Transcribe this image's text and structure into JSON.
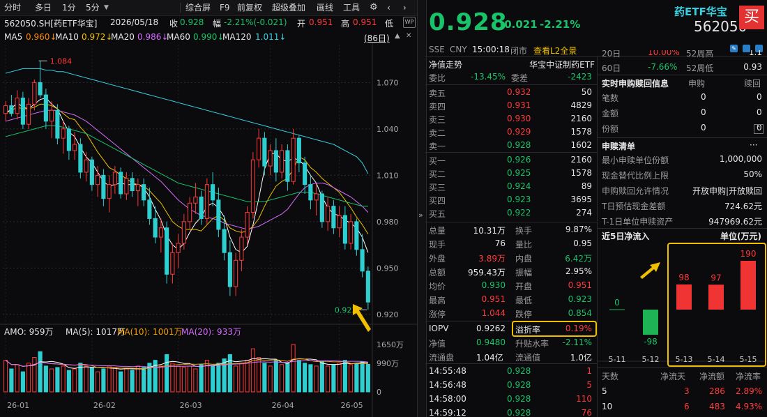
{
  "toolbar": {
    "tabs": [
      "分时",
      "多日",
      "1分",
      "5分"
    ],
    "dropdown_icon": "chevron-down-icon",
    "right": [
      "综合屏",
      "F9",
      "前复权",
      "超级叠加",
      "画线",
      "工具"
    ]
  },
  "info": {
    "code": "562050.SH[药ETF华宝]",
    "date": "2026/05/18",
    "close_label": "收",
    "close": "0.928",
    "amp_label": "幅",
    "amp": "-2.21%(-0.021)",
    "open_label": "开",
    "open": "0.951",
    "high_label": "高",
    "high": "0.951",
    "low_label": "低"
  },
  "ma": {
    "ma5_label": "MA5",
    "ma5": "0.960↓",
    "ma10_label": "MA10",
    "ma10": "0.972↓",
    "ma20_label": "MA20",
    "ma20": "0.986↓",
    "ma60_label": "MA60",
    "ma60": "0.990↓",
    "ma120_label": "MA120",
    "ma120": "1.011↓",
    "period": "(86日)"
  },
  "chart_data": {
    "type": "candlestick",
    "yticks": [
      "1.070",
      "1.040",
      "1.010",
      "0.980",
      "0.950",
      "0.920"
    ],
    "ylim": [
      0.915,
      1.09
    ],
    "max_label": "1.084",
    "min_label": "0.923",
    "xticks": [
      "26-01",
      "26-02",
      "26-03",
      "26-04",
      "26-05"
    ],
    "volume": {
      "label_text": "AMO: 959万",
      "ma5_text": "MA(5): 1017万",
      "ma10_text": "MA(10): 1001万",
      "ma20_text": "MA(20): 933万",
      "yticks": [
        "1650万",
        "990万",
        "0"
      ],
      "max": 1650
    },
    "candles": [
      [
        1.05,
        1.058,
        1.045,
        1.055
      ],
      [
        1.055,
        1.062,
        1.048,
        1.05
      ],
      [
        1.05,
        1.065,
        1.046,
        1.06
      ],
      [
        1.06,
        1.064,
        1.04,
        1.043
      ],
      [
        1.043,
        1.06,
        1.04,
        1.056
      ],
      [
        1.056,
        1.072,
        1.052,
        1.07
      ],
      [
        1.07,
        1.084,
        1.06,
        1.062
      ],
      [
        1.062,
        1.066,
        1.04,
        1.045
      ],
      [
        1.045,
        1.058,
        1.034,
        1.052
      ],
      [
        1.052,
        1.056,
        1.03,
        1.034
      ],
      [
        1.034,
        1.045,
        1.024,
        1.04
      ],
      [
        1.04,
        1.042,
        1.02,
        1.026
      ],
      [
        1.026,
        1.038,
        1.02,
        1.03
      ],
      [
        1.03,
        1.034,
        1.008,
        1.012
      ],
      [
        1.012,
        1.025,
        1.006,
        1.02
      ],
      [
        1.02,
        1.022,
        1.0,
        1.004
      ],
      [
        1.004,
        1.016,
        0.996,
        1.01
      ],
      [
        1.01,
        1.014,
        0.99,
        0.995
      ],
      [
        0.995,
        1.01,
        0.986,
        1.004
      ],
      [
        1.004,
        1.016,
        0.998,
        1.012
      ],
      [
        1.012,
        1.015,
        0.995,
        0.998
      ],
      [
        0.998,
        1.012,
        0.994,
        1.008
      ],
      [
        1.008,
        1.012,
        0.996,
        1.0
      ],
      [
        1.0,
        1.008,
        0.99,
        1.004
      ],
      [
        1.004,
        1.008,
        0.99,
        0.994
      ],
      [
        0.994,
        1.002,
        0.978,
        0.982
      ],
      [
        0.982,
        0.99,
        0.966,
        0.97
      ],
      [
        0.97,
        0.982,
        0.96,
        0.976
      ],
      [
        0.976,
        0.98,
        0.94,
        0.946
      ],
      [
        0.946,
        0.966,
        0.94,
        0.96
      ],
      [
        0.96,
        0.972,
        0.95,
        0.966
      ],
      [
        0.966,
        0.985,
        0.962,
        0.98
      ],
      [
        0.98,
        0.996,
        0.975,
        0.992
      ],
      [
        0.992,
        1.005,
        0.985,
        0.996
      ],
      [
        0.996,
        1.0,
        0.978,
        0.982
      ],
      [
        0.982,
        1.008,
        0.978,
        1.004
      ],
      [
        1.004,
        1.012,
        0.99,
        0.994
      ],
      [
        0.994,
        1.002,
        0.97,
        0.975
      ],
      [
        0.975,
        0.984,
        0.955,
        0.96
      ],
      [
        0.96,
        0.968,
        0.932,
        0.938
      ],
      [
        0.938,
        0.96,
        0.932,
        0.955
      ],
      [
        0.955,
        0.975,
        0.948,
        0.97
      ],
      [
        0.97,
        0.99,
        0.965,
        0.986
      ],
      [
        0.986,
        1.025,
        0.982,
        1.02
      ],
      [
        1.02,
        1.04,
        1.015,
        1.034
      ],
      [
        1.034,
        1.038,
        1.01,
        1.016
      ],
      [
        1.016,
        1.03,
        1.01,
        1.026
      ],
      [
        1.026,
        1.034,
        1.006,
        1.012
      ],
      [
        1.012,
        1.03,
        1.008,
        1.026
      ],
      [
        1.026,
        1.03,
        1.0,
        1.006
      ],
      [
        1.006,
        1.04,
        1.004,
        1.034
      ],
      [
        1.034,
        1.036,
        1.012,
        1.018
      ],
      [
        1.018,
        1.022,
        0.998,
        1.004
      ],
      [
        1.004,
        1.01,
        0.988,
        0.994
      ],
      [
        0.994,
        1.004,
        0.984,
        0.998
      ],
      [
        0.998,
        1.0,
        0.976,
        0.98
      ],
      [
        0.98,
        0.996,
        0.974,
        0.99
      ],
      [
        0.99,
        0.994,
        0.972,
        0.976
      ],
      [
        0.976,
        0.99,
        0.97,
        0.984
      ],
      [
        0.984,
        0.99,
        0.962,
        0.966
      ],
      [
        0.966,
        0.985,
        0.962,
        0.98
      ],
      [
        0.98,
        0.982,
        0.958,
        0.962
      ],
      [
        0.962,
        0.972,
        0.944,
        0.948
      ],
      [
        0.948,
        0.951,
        0.923,
        0.928
      ]
    ],
    "ma_series": [
      {
        "color": "#ffffff",
        "values": [
          1.05,
          1.053,
          1.057,
          1.054,
          1.053,
          1.056,
          1.059,
          1.06,
          1.056,
          1.053,
          1.045,
          1.038,
          1.035,
          1.028,
          1.022,
          1.018,
          1.012,
          1.006,
          1.003,
          1.004,
          1.005,
          1.004,
          1.004,
          1.004,
          1.002,
          0.996,
          0.988,
          0.981,
          0.971,
          0.965,
          0.962,
          0.966,
          0.973,
          0.979,
          0.983,
          0.99,
          0.992,
          0.989,
          0.983,
          0.97,
          0.962,
          0.96,
          0.964,
          0.978,
          0.995,
          1.014,
          1.024,
          1.024,
          1.02,
          1.019,
          1.021,
          1.02,
          1.016,
          1.01,
          1.005,
          0.996,
          0.989,
          0.985,
          0.984,
          0.981,
          0.979,
          0.976,
          0.97,
          0.96
        ]
      },
      {
        "color": "#f0c000",
        "values": [
          1.05,
          1.052,
          1.054,
          1.053,
          1.053,
          1.054,
          1.056,
          1.056,
          1.055,
          1.053,
          1.05,
          1.047,
          1.046,
          1.041,
          1.037,
          1.031,
          1.025,
          1.02,
          1.015,
          1.013,
          1.01,
          1.008,
          1.005,
          1.004,
          1.003,
          1.0,
          0.996,
          0.992,
          0.986,
          0.98,
          0.977,
          0.975,
          0.975,
          0.975,
          0.974,
          0.978,
          0.982,
          0.984,
          0.981,
          0.976,
          0.974,
          0.973,
          0.974,
          0.977,
          0.982,
          0.99,
          0.997,
          1.003,
          1.006,
          1.008,
          1.014,
          1.022,
          1.02,
          1.015,
          1.012,
          1.008,
          1.005,
          1.002,
          0.999,
          0.994,
          0.989,
          0.983,
          0.978,
          0.972
        ]
      },
      {
        "color": "#d66bff",
        "values": [
          1.045,
          1.046,
          1.047,
          1.048,
          1.049,
          1.05,
          1.051,
          1.052,
          1.052,
          1.052,
          1.051,
          1.05,
          1.049,
          1.047,
          1.045,
          1.042,
          1.039,
          1.036,
          1.033,
          1.03,
          1.027,
          1.024,
          1.021,
          1.018,
          1.015,
          1.012,
          1.009,
          1.006,
          1.002,
          0.998,
          0.994,
          0.991,
          0.988,
          0.986,
          0.984,
          0.983,
          0.982,
          0.981,
          0.979,
          0.978,
          0.977,
          0.976,
          0.975,
          0.976,
          0.977,
          0.979,
          0.981,
          0.983,
          0.985,
          0.988,
          0.993,
          0.998,
          1.002,
          1.004,
          1.005,
          1.005,
          1.004,
          1.002,
          1.0,
          0.998,
          0.996,
          0.993,
          0.99,
          0.986
        ]
      },
      {
        "color": "#19c36a",
        "values": [
          1.035,
          1.036,
          1.037,
          1.038,
          1.039,
          1.04,
          1.041,
          1.042,
          1.042,
          1.042,
          1.041,
          1.04,
          1.039,
          1.038,
          1.037,
          1.035,
          1.033,
          1.031,
          1.029,
          1.027,
          1.025,
          1.023,
          1.021,
          1.019,
          1.017,
          1.015,
          1.013,
          1.011,
          1.009,
          1.007,
          1.005,
          1.004,
          1.003,
          1.002,
          1.001,
          1.0,
          0.999,
          0.998,
          0.997,
          0.996,
          0.995,
          0.994,
          0.993,
          0.993,
          0.993,
          0.993,
          0.994,
          0.995,
          0.996,
          0.997,
          0.998,
          0.999,
          0.999,
          0.999,
          0.998,
          0.997,
          0.996,
          0.995,
          0.994,
          0.993,
          0.992,
          0.991,
          0.99,
          0.99
        ]
      },
      {
        "color": "#37d0e0",
        "values": [
          1.076,
          1.077,
          1.078,
          1.079,
          1.079,
          1.079,
          1.079,
          1.078,
          1.078,
          1.077,
          1.077,
          1.076,
          1.075,
          1.074,
          1.073,
          1.072,
          1.071,
          1.07,
          1.069,
          1.068,
          1.067,
          1.066,
          1.065,
          1.064,
          1.063,
          1.062,
          1.061,
          1.06,
          1.059,
          1.058,
          1.057,
          1.056,
          1.055,
          1.054,
          1.053,
          1.052,
          1.051,
          1.05,
          1.049,
          1.048,
          1.047,
          1.046,
          1.045,
          1.044,
          1.043,
          1.042,
          1.041,
          1.04,
          1.039,
          1.038,
          1.037,
          1.036,
          1.035,
          1.034,
          1.033,
          1.032,
          1.031,
          1.03,
          1.028,
          1.026,
          1.024,
          1.022,
          1.018,
          1.011
        ]
      }
    ],
    "volumes": [
      1100,
      800,
      950,
      700,
      1000,
      1200,
      1400,
      900,
      800,
      850,
      900,
      750,
      800,
      1000,
      900,
      850,
      700,
      800,
      900,
      850,
      700,
      800,
      750,
      900,
      850,
      1000,
      1100,
      900,
      1300,
      1000,
      900,
      850,
      900,
      800,
      950,
      1100,
      900,
      1000,
      1150,
      1300,
      900,
      1000,
      1100,
      1500,
      1200,
      1000,
      900,
      1100,
      950,
      1000,
      1650,
      1100,
      1000,
      950,
      900,
      1050,
      900,
      950,
      1000,
      1100,
      950,
      1000,
      1050,
      959
    ],
    "net_inflow": {
      "title": "近5日净流入",
      "unit": "单位(万元)",
      "dates": [
        "5-11",
        "5-12",
        "5-13",
        "5-14",
        "5-15"
      ],
      "values": [
        0,
        -98,
        98,
        97,
        190
      ],
      "labels": [
        "0",
        "-98",
        "98",
        "97",
        "190"
      ]
    }
  },
  "quote": {
    "price": "0.928",
    "change": "-0.021",
    "pct": "-2.21%",
    "title": "药ETF华宝",
    "code": "562050",
    "buy_label": "买",
    "exchange": "SSE",
    "currency": "CNY",
    "time": "15:00:18",
    "market_state": "闭市",
    "l2_link": "查看L2全景"
  },
  "orderbook": {
    "section": "净值走势",
    "section_right": "华宝中证制药ETF",
    "weibi_label": "委比",
    "weibi": "-13.45%",
    "weicha_label": "委差",
    "weicha": "-2423",
    "sells": [
      {
        "l": "卖五",
        "p": "0.932",
        "v": "50"
      },
      {
        "l": "卖四",
        "p": "0.931",
        "v": "4829"
      },
      {
        "l": "卖三",
        "p": "0.930",
        "v": "2160"
      },
      {
        "l": "卖二",
        "p": "0.929",
        "v": "1578"
      },
      {
        "l": "卖一",
        "p": "0.928",
        "v": "1602"
      }
    ],
    "buys": [
      {
        "l": "买一",
        "p": "0.926",
        "v": "2160"
      },
      {
        "l": "买二",
        "p": "0.925",
        "v": "1578"
      },
      {
        "l": "买三",
        "p": "0.924",
        "v": "89"
      },
      {
        "l": "买四",
        "p": "0.923",
        "v": "3695"
      },
      {
        "l": "买五",
        "p": "0.922",
        "v": "274"
      }
    ]
  },
  "stats": [
    {
      "l1": "总量",
      "v1": "10.31万",
      "c1": "wht",
      "l2": "换手",
      "v2": "9.87%",
      "c2": "wht"
    },
    {
      "l1": "现手",
      "v1": "76",
      "c1": "wht",
      "l2": "量比",
      "v2": "0.95",
      "c2": "wht"
    },
    {
      "l1": "外盘",
      "v1": "3.89万",
      "c1": "red",
      "l2": "内盘",
      "v2": "6.42万",
      "c2": "grn"
    },
    {
      "l1": "总额",
      "v1": "959.43万",
      "c1": "wht",
      "l2": "振幅",
      "v2": "2.95%",
      "c2": "wht"
    },
    {
      "l1": "均价",
      "v1": "0.930",
      "c1": "grn",
      "l2": "开盘",
      "v2": "0.951",
      "c2": "red"
    },
    {
      "l1": "最高",
      "v1": "0.951",
      "c1": "red",
      "l2": "最低",
      "v2": "0.923",
      "c2": "grn"
    },
    {
      "l1": "涨停",
      "v1": "1.044",
      "c1": "red",
      "l2": "跌停",
      "v2": "0.854",
      "c2": "grn"
    }
  ],
  "iopv": {
    "label": "IOPV",
    "value": "0.9262",
    "disc_label": "溢折率",
    "disc": "0.19%"
  },
  "nav": {
    "label": "净值",
    "value": "0.9480",
    "prem_label": "升贴水率",
    "prem": "-2.11%"
  },
  "float": {
    "label1": "流通盘",
    "v1": "1.04亿",
    "label2": "流通值",
    "v2": "1.0亿"
  },
  "ticks": [
    {
      "t": "14:55:48",
      "p": "0.928",
      "v": "1",
      "c": "red"
    },
    {
      "t": "14:56:48",
      "p": "0.928",
      "v": "5",
      "c": "red"
    },
    {
      "t": "14:58:00",
      "p": "0.928",
      "v": "110",
      "c": "red"
    },
    {
      "t": "14:59:12",
      "p": "0.928",
      "v": "76",
      "c": "red"
    }
  ],
  "rightTop": {
    "partial1": "20日",
    "partial2": "10.00%",
    "partial3": "52周高",
    "partial4": "1.1",
    "d60_label": "60日",
    "d60": "-7.66%",
    "w52_label": "52周低",
    "w52": "0.93"
  },
  "realtime": {
    "title": "实时申购赎回信息",
    "col1": "申购",
    "col2": "赎回",
    "rows": [
      {
        "l": "笔数",
        "a": "0",
        "b": "0"
      },
      {
        "l": "金额",
        "a": "0",
        "b": "0"
      },
      {
        "l": "份额",
        "a": "0",
        "b": "0"
      }
    ]
  },
  "creation": {
    "title": "申赎清单",
    "more": "···",
    "rows": [
      {
        "l": "最小申赎单位份额",
        "v": "1,000,000"
      },
      {
        "l": "现金替代比例上限",
        "v": "50%"
      },
      {
        "l": "申购赎回允许情况",
        "v": "开放申购|开放赎回"
      },
      {
        "l": "T日预估现金差额",
        "v": "724.62元"
      },
      {
        "l": "T-1日单位申赎资产",
        "v": "947969.62元"
      }
    ]
  },
  "summary": {
    "head": [
      "天数",
      "净流天",
      "净流额",
      "净流率"
    ],
    "rows": [
      {
        "d": "5",
        "days": "3",
        "amt": "286",
        "rate": "2.89%"
      },
      {
        "d": "10",
        "days": "6",
        "amt": "483",
        "rate": "4.93%"
      }
    ]
  },
  "icons": [
    "gear-icon",
    "chevron-left-icon",
    "chevron-right-icon",
    "double-chevron-right-icon",
    "close-icon",
    "expand-icon"
  ]
}
